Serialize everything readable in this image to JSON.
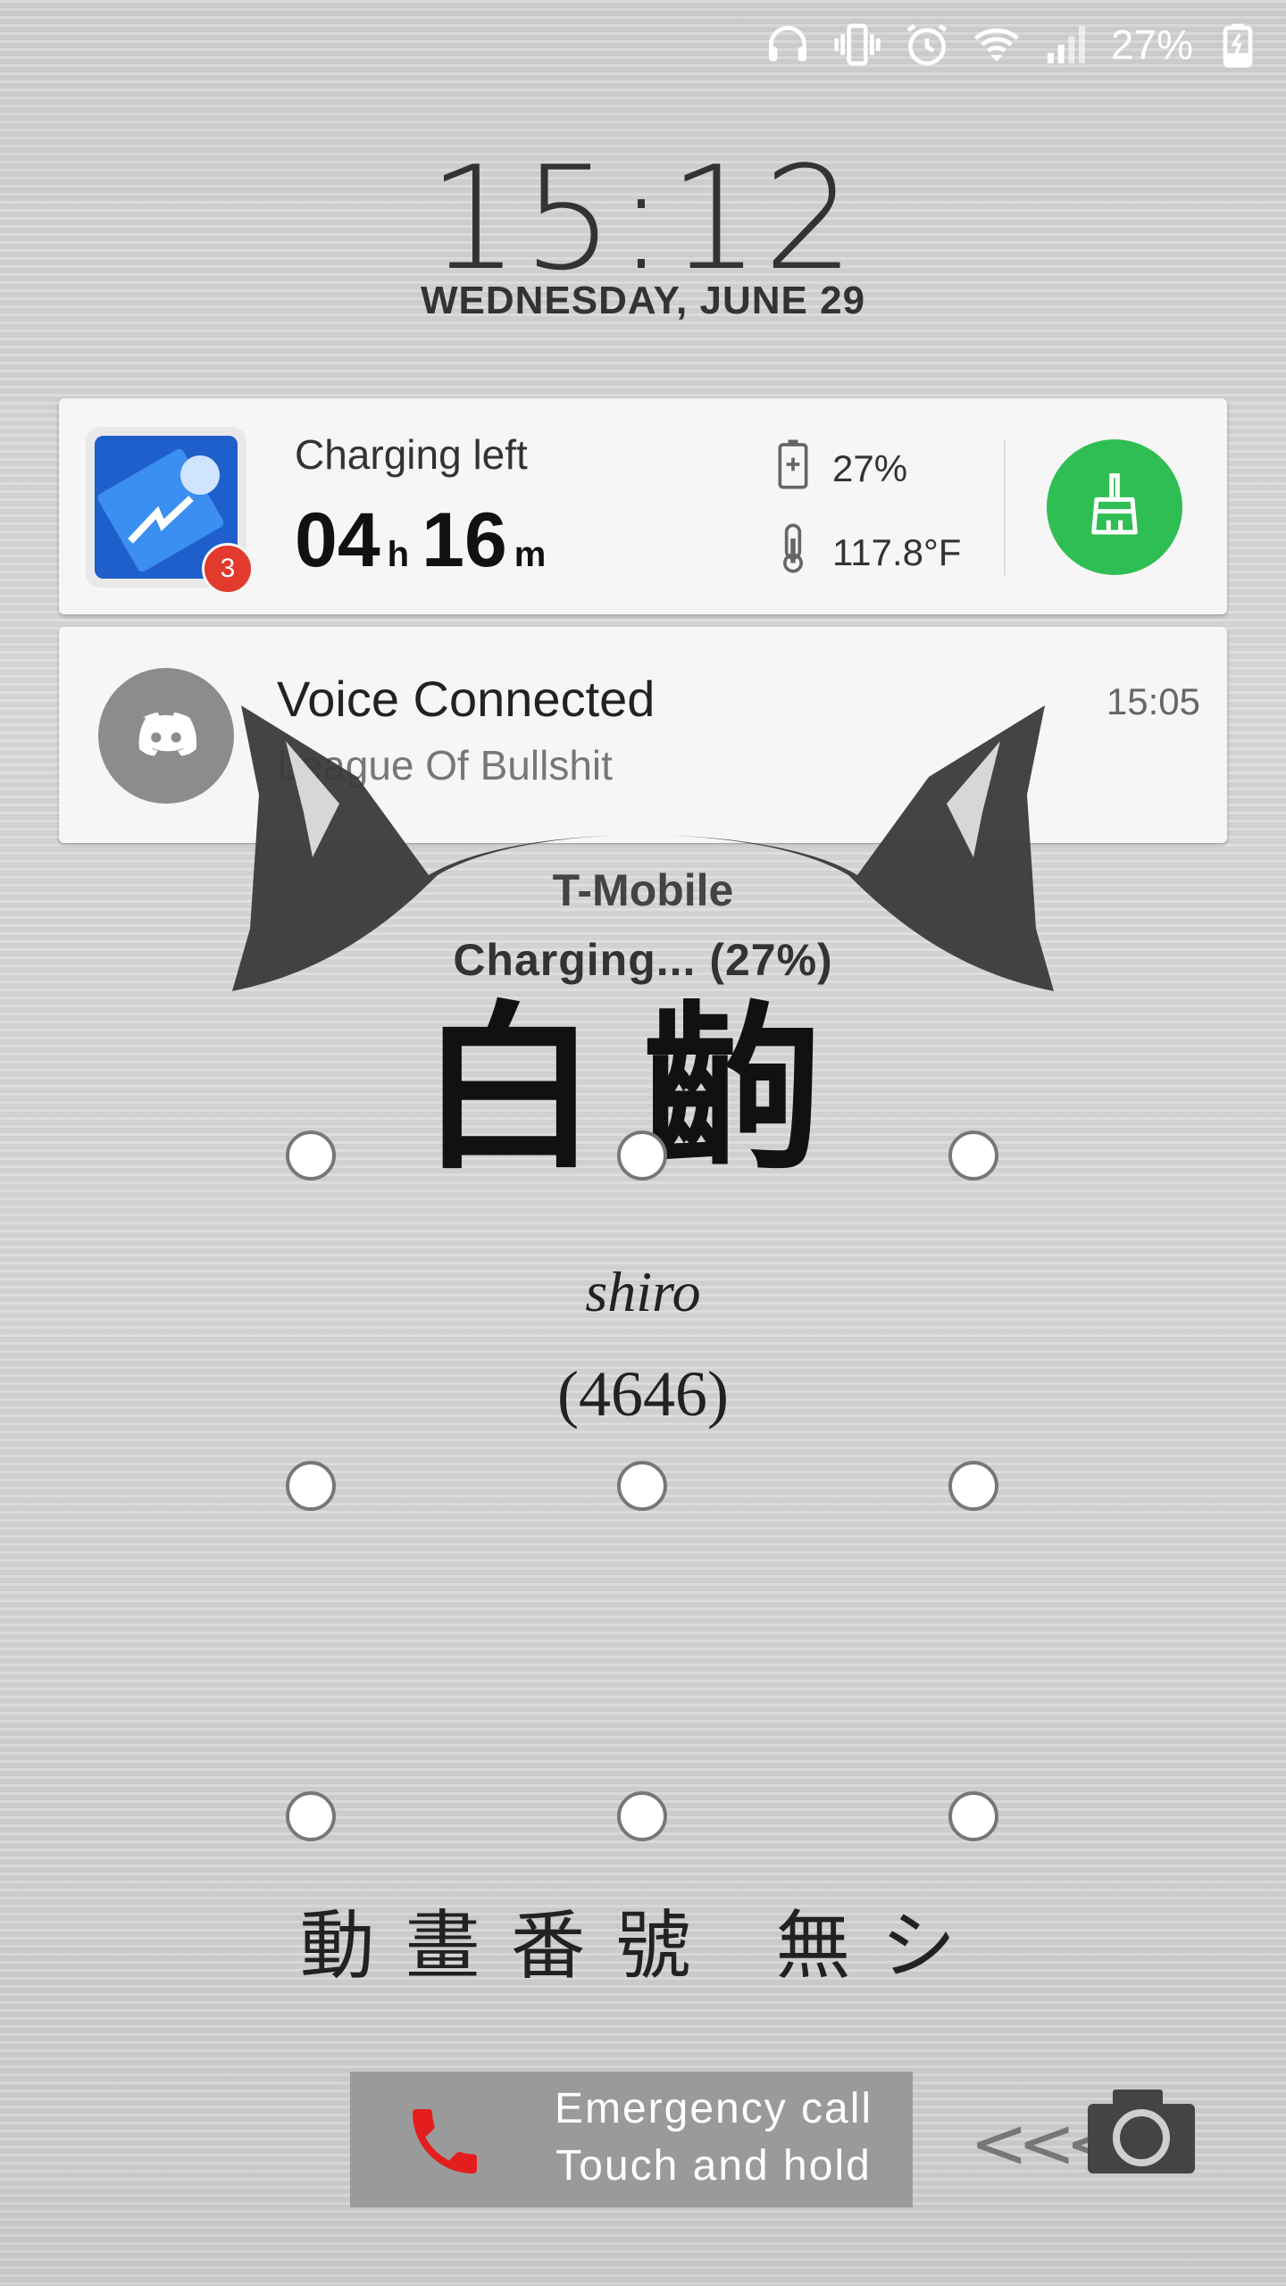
{
  "status_bar": {
    "battery_percent": "27%",
    "icons": [
      "headset-icon",
      "vibrate-icon",
      "alarm-icon",
      "wifi-icon",
      "signal-icon",
      "battery-charging-icon"
    ]
  },
  "lockscreen": {
    "time": "15:12",
    "date": "WEDNESDAY, JUNE 29"
  },
  "battery_widget": {
    "label": "Charging left",
    "hours": "04",
    "hours_unit": "h",
    "minutes": "16",
    "minutes_unit": "m",
    "badge_count": "3",
    "battery_level": "27%",
    "temperature": "117.8°F",
    "clean_button_icon": "broom-icon",
    "accent_color": "#2fbe53"
  },
  "notification": {
    "title": "Voice Connected",
    "subtitle": "League Of Bullshit",
    "time": "15:05",
    "app_icon": "discord-icon"
  },
  "wallpaper": {
    "carrier": "T-Mobile",
    "charging_status": "Charging... (27%)",
    "kanji": "白齣",
    "name": "shiro",
    "code": "(4646)",
    "bottom_text": "動畫番號 無シ"
  },
  "bottom": {
    "emergency_line1": "Emergency call",
    "emergency_line2": "Touch and hold",
    "camera_icon": "camera-icon",
    "chevrons": "<<<"
  }
}
